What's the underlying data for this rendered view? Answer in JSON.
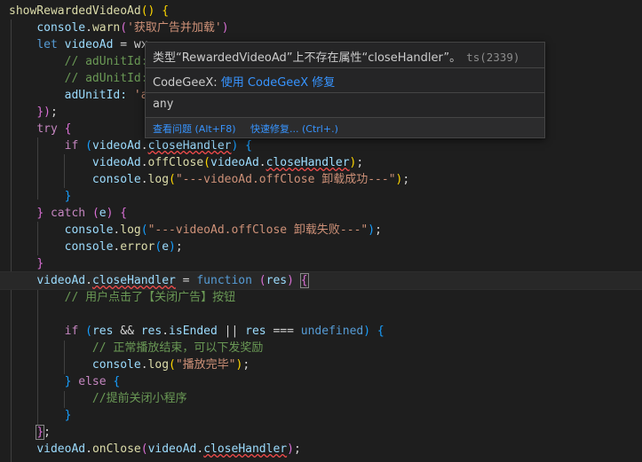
{
  "code": {
    "l1_fn": "showRewardedVideoAd",
    "l1_rest": "() {",
    "l2_obj": "console",
    "l2_fn": "warn",
    "l2_str": "'获取广告并加载'",
    "l3_kw": "let",
    "l3_var": "videoAd",
    "l3_rest": "= wx",
    "l4_comment": "// adUnitId:",
    "l5_comment": "// adUnitId:",
    "l6_prop": "adUnitId:",
    "l6_str": "'a",
    "l7": "});",
    "l8_kw": "try",
    "l9_kw": "if",
    "l9_obj": "videoAd",
    "l9_prop": "closeHandler",
    "l10_obj": "videoAd",
    "l10_fn": "offClose",
    "l10_obj2": "videoAd",
    "l10_prop": "closeHandler",
    "l11_obj": "console",
    "l11_fn": "log",
    "l11_str": "\"---videoAd.offClose 卸载成功---\"",
    "l13_kw": "catch",
    "l13_var": "e",
    "l14_obj": "console",
    "l14_fn": "log",
    "l14_str": "\"---videoAd.offClose 卸载失败---\"",
    "l15_obj": "console",
    "l15_fn": "error",
    "l15_var": "e",
    "l17_obj": "videoAd",
    "l17_prop": "closeHandler",
    "l17_kw": "function",
    "l17_param": "res",
    "l18_comment": "// 用户点击了【关闭广告】按钮",
    "l20_kw": "if",
    "l20_v1": "res",
    "l20_v2": "res",
    "l20_prop": "isEnded",
    "l20_v3": "res",
    "l20_undef": "undefined",
    "l21_comment": "// 正常播放结束，可以下发奖励",
    "l22_obj": "console",
    "l22_fn": "log",
    "l22_str": "\"播放完毕\"",
    "l23_kw": "else",
    "l24_comment": "//提前关闭小程序",
    "l27_obj": "videoAd",
    "l27_fn": "onClose",
    "l27_obj2": "videoAd",
    "l27_prop": "closeHandler"
  },
  "hover": {
    "message": "类型“RewardedVideoAd”上不存在属性“closeHandler”。",
    "code": "ts(2339)",
    "codegeex_label": "CodeGeeX:",
    "codegeex_link": "使用 CodeGeeX 修复",
    "type_text": "any",
    "view_problem": "查看问题 (Alt+F8)",
    "quick_fix": "快速修复... (Ctrl+.)"
  },
  "colors": {
    "background": "#1e1e1e",
    "keyword": "#c586c0",
    "storage": "#569cd6",
    "function": "#dcdcaa",
    "variable": "#9cdcfe",
    "string": "#ce9178",
    "comment": "#6a9955",
    "error_squiggle": "#f14c4c",
    "link": "#3794ff"
  }
}
